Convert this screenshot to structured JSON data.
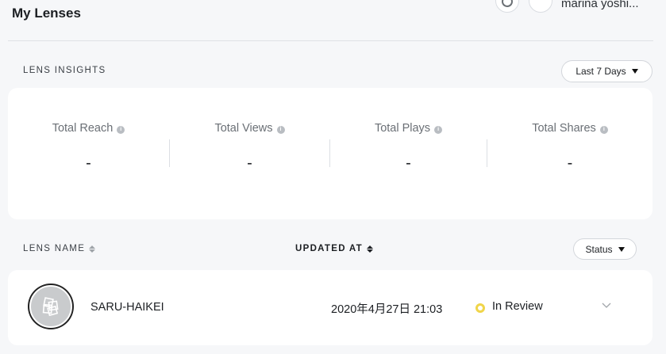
{
  "header": {
    "title": "My Lenses",
    "user_name": "marina yoshi..."
  },
  "insights": {
    "label": "LENS INSIGHTS",
    "range": "Last 7 Days",
    "stats": [
      {
        "label": "Total Reach",
        "value": "-"
      },
      {
        "label": "Total Views",
        "value": "-"
      },
      {
        "label": "Total Plays",
        "value": "-"
      },
      {
        "label": "Total Shares",
        "value": "-"
      }
    ]
  },
  "table": {
    "col_name": "LENS NAME",
    "col_updated": "UPDATED AT",
    "status_filter": "Status",
    "rows": [
      {
        "name": "SARU-HAIKEI",
        "updated_at": "2020年4月27日 21:03",
        "status": "In Review",
        "status_color": "#f0d54a"
      }
    ]
  },
  "icons": [
    "refresh-icon",
    "avatar",
    "info-icon",
    "caret-down-icon",
    "sort-icon",
    "lens-thumbnail",
    "status-dot",
    "chevron-down-icon"
  ]
}
